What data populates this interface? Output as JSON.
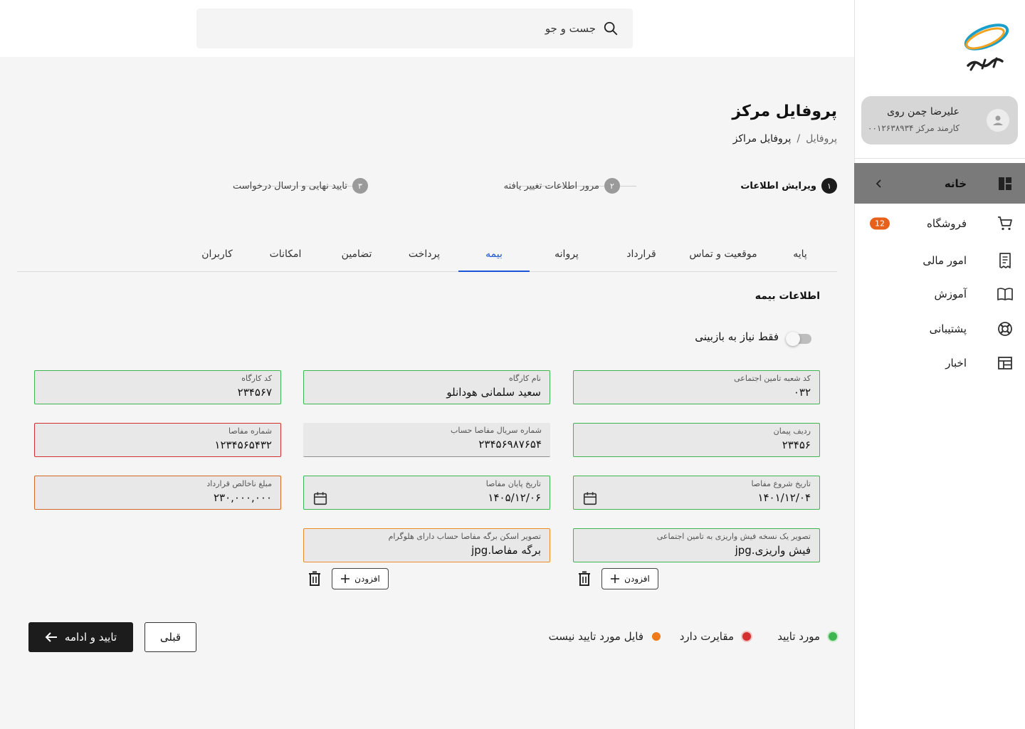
{
  "search": {
    "placeholder": "جست و جو"
  },
  "user": {
    "name": "علیرضا چمن روی",
    "subtitle": "کارمند مرکز ۰۰۱۲۶۳۸۹۳۴"
  },
  "nav": [
    {
      "label": "خانه",
      "icon": "dashboard-icon",
      "active": true
    },
    {
      "label": "فروشگاه",
      "icon": "cart-icon",
      "badge": "12"
    },
    {
      "label": "امور مالی",
      "icon": "receipt-icon"
    },
    {
      "label": "آموزش",
      "icon": "book-icon"
    },
    {
      "label": "پشتیبانی",
      "icon": "lifebuoy-icon"
    },
    {
      "label": "اخبار",
      "icon": "news-icon"
    }
  ],
  "page": {
    "title": "پروفایل مرکز",
    "breadcrumb": [
      "پروفایل",
      "پروفایل مراکز"
    ]
  },
  "stepper": [
    {
      "num": "۱",
      "label": "ویرایش اطلاعات",
      "active": true
    },
    {
      "num": "۲",
      "label": "مرور اطلاعات تغییر یافته"
    },
    {
      "num": "۳",
      "label": "تایید نهایی و ارسال درخواست"
    }
  ],
  "tabs": [
    "پایه",
    "موقعیت و تماس",
    "قرارداد",
    "پروانه",
    "بیمه",
    "پرداخت",
    "تضامین",
    "امکانات",
    "کاربران"
  ],
  "active_tab": "بیمه",
  "section_title": "اطلاعات بیمه",
  "toggle_label": "فقط نیاز به بازبینی",
  "fields": {
    "branch_code": {
      "label": "کد شعبه تامین اجتماعی",
      "value": "۰۳۲"
    },
    "workshop_name": {
      "label": "نام کارگاه",
      "value": "سعید سلمانی هودانلو"
    },
    "workshop_code": {
      "label": "کد کارگاه",
      "value": "۲۳۴۵۶۷"
    },
    "contract_row": {
      "label": "ردیف پیمان",
      "value": "۲۳۴۵۶"
    },
    "serial_number": {
      "label": "شماره سریال مفاصا حساب",
      "value": "۲۳۴۵۶۹۸۷۶۵۴"
    },
    "clearance_number": {
      "label": "شماره مفاصا",
      "value": "۱۲۳۴۵۶۵۴۳۲"
    },
    "start_date": {
      "label": "تاریخ شروع مفاصا",
      "value": "۱۴۰۱/۱۲/۰۴"
    },
    "end_date": {
      "label": "تاریخ پایان مفاصا",
      "value": "۱۴۰۵/۱۲/۰۶"
    },
    "gross_amount": {
      "label": "مبلغ ناخالص قرارداد",
      "value": "۲۳۰,۰۰۰,۰۰۰"
    },
    "receipt_image": {
      "label": "تصویر یک نسخه فیش واریزی به تامین اجتماعی",
      "value": "فیش واریزی.jpg"
    },
    "clearance_image": {
      "label": "تصویر اسکن برگه مفاصا حساب دارای هلوگرام",
      "value": "برگه مفاصا.jpg"
    }
  },
  "add_label": "افزودن",
  "legend": [
    {
      "label": "مورد تایید",
      "color": "#3fb650"
    },
    {
      "label": "مقایرت دارد",
      "color": "#d23030"
    },
    {
      "label": "فایل مورد تایید نیست",
      "color": "#ef7a1a"
    }
  ],
  "buttons": {
    "prev": "قبلی",
    "next": "تایید و ادامه"
  },
  "colors": {
    "accent": "#1a56d6",
    "active_nav": "#7a7a7a",
    "badge": "#e8611a"
  }
}
